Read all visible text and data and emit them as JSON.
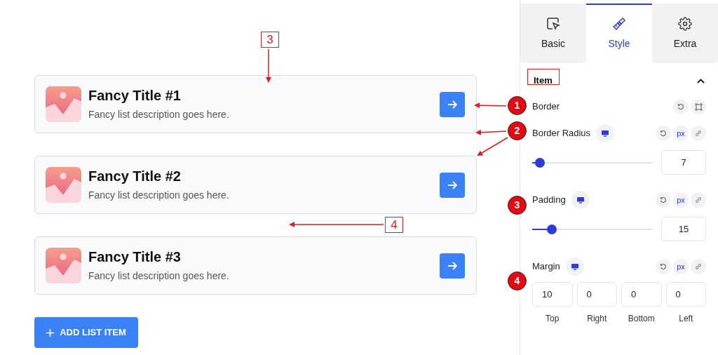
{
  "cards": [
    {
      "title": "Fancy Title #1",
      "description": "Fancy list description goes here."
    },
    {
      "title": "Fancy Title #2",
      "description": "Fancy list description goes here."
    },
    {
      "title": "Fancy Title #3",
      "description": "Fancy list description goes here."
    }
  ],
  "add_button": {
    "label": "ADD LIST ITEM"
  },
  "panel": {
    "tabs": [
      {
        "label": "Basic",
        "selected": false
      },
      {
        "label": "Style",
        "selected": true
      },
      {
        "label": "Extra",
        "selected": false
      }
    ],
    "section": {
      "title": "Item",
      "expanded": true
    },
    "controls": [
      {
        "kind": "plain",
        "label": "Border"
      },
      {
        "kind": "slider",
        "label": "Border Radius",
        "unit": "px",
        "level": 0.065,
        "value": "7"
      },
      {
        "kind": "slider",
        "label": "Padding",
        "unit": "px",
        "level": 0.16,
        "value": "15"
      },
      {
        "kind": "quad",
        "label": "Margin",
        "unit": "px",
        "fields": [
          {
            "value": "10",
            "caption": "Top"
          },
          {
            "value": "0",
            "caption": "Right"
          },
          {
            "value": "0",
            "caption": "Bottom"
          },
          {
            "value": "0",
            "caption": "Left"
          }
        ]
      }
    ]
  },
  "callouts": [
    {
      "kind": "box",
      "label": "3"
    },
    {
      "kind": "circle",
      "label": "1"
    },
    {
      "kind": "circle",
      "label": "2"
    },
    {
      "kind": "circle",
      "label": "3"
    },
    {
      "kind": "box",
      "label": "4"
    },
    {
      "kind": "circle",
      "label": "4"
    }
  ]
}
